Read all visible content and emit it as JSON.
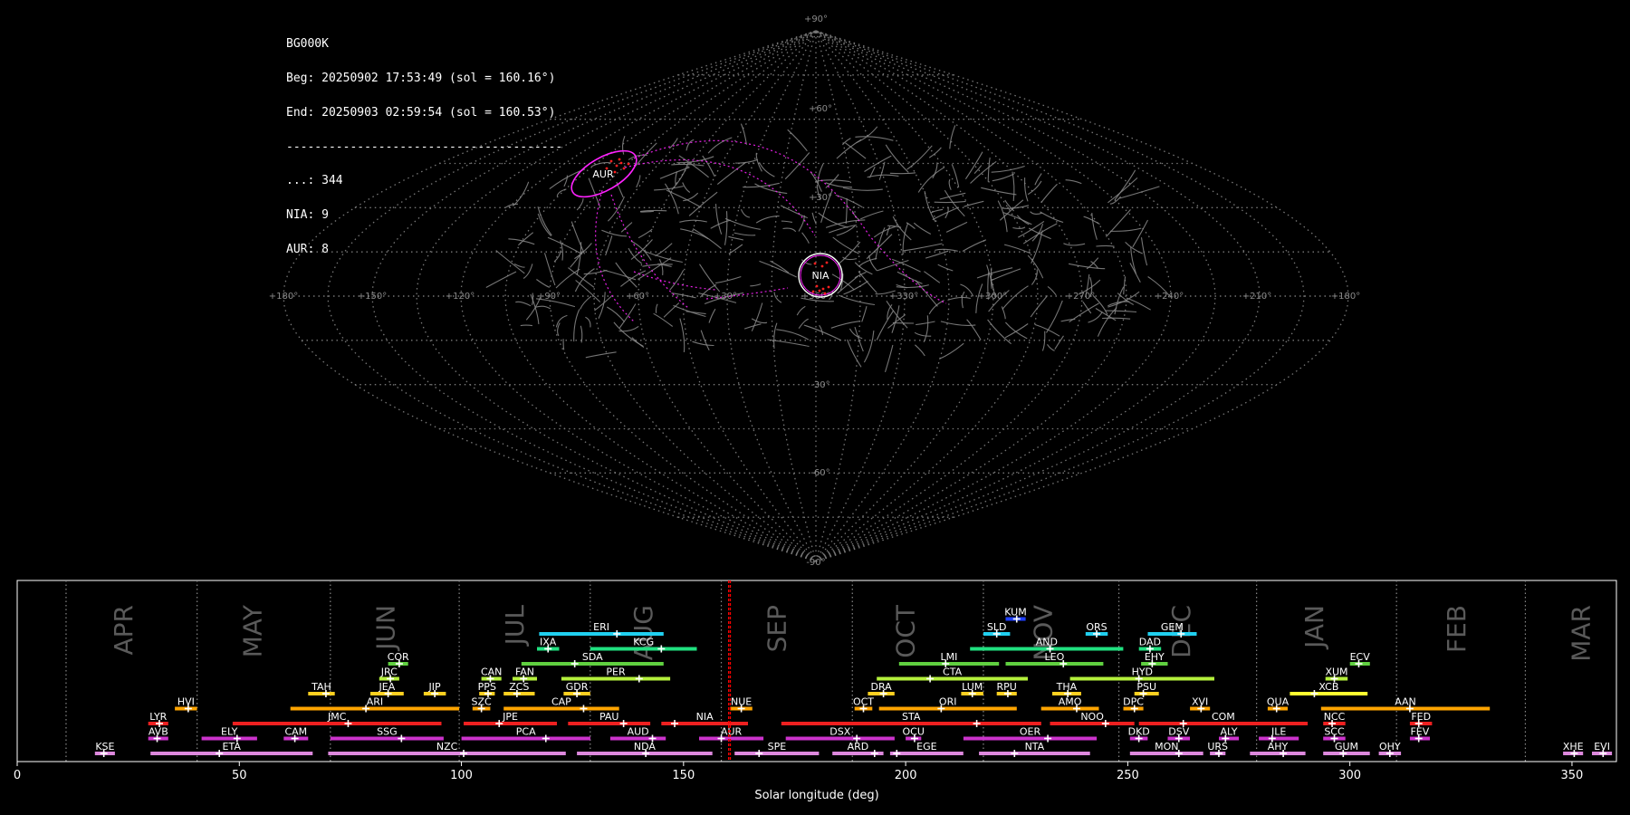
{
  "info": {
    "station": "BG000K",
    "beg": "Beg: 20250902 17:53:49 (sol = 160.16°)",
    "end": "End: 20250903 02:59:54 (sol = 160.53°)",
    "separator": "---------------------------------------",
    "counts": [
      "...: 344",
      "NIA: 9",
      "AUR: 8"
    ]
  },
  "sky": {
    "lat_labels": [
      "+90°",
      "+60°",
      "+30°",
      "-30°",
      "-60°",
      "-90°"
    ],
    "lon_labels": [
      "+180°",
      "+150°",
      "+120°",
      "+90°",
      "+60°",
      "+30°",
      "+360°",
      "+330°",
      "+300°",
      "+270°",
      "+240°",
      "+210°",
      "+180°"
    ],
    "highlight_radiants": [
      "AUR",
      "NIA"
    ],
    "colors": {
      "grid": "#777777",
      "tracks": "#8a8a8a",
      "highlight": "#ff22ff",
      "radiant_point": "#ff2020"
    }
  },
  "chart_data": {
    "type": "timeline",
    "xlabel": "Solar longitude (deg)",
    "xlim": [
      0,
      360
    ],
    "xticks": [
      0,
      50,
      100,
      150,
      200,
      250,
      300,
      350
    ],
    "current_sol": [
      160.16,
      160.53
    ],
    "month_labels": [
      {
        "name": "APR",
        "x": 24
      },
      {
        "name": "MAY",
        "x": 53
      },
      {
        "name": "JUN",
        "x": 83
      },
      {
        "name": "JUL",
        "x": 112
      },
      {
        "name": "AUG",
        "x": 141
      },
      {
        "name": "SEP",
        "x": 171
      },
      {
        "name": "OCT",
        "x": 200
      },
      {
        "name": "NOV",
        "x": 231
      },
      {
        "name": "DEC",
        "x": 262
      },
      {
        "name": "JAN",
        "x": 292
      },
      {
        "name": "FEB",
        "x": 324
      },
      {
        "name": "MAR",
        "x": 352
      }
    ],
    "month_boundaries": [
      11,
      40.5,
      70.5,
      99.5,
      129,
      158.5,
      188,
      217.5,
      248,
      279,
      310.5,
      339.5
    ],
    "showers": [
      {
        "name": "KSE",
        "start": 17.5,
        "end": 22,
        "peak": 19.5,
        "row": 0,
        "color": "#dd88dd"
      },
      {
        "name": "ETA",
        "start": 30,
        "end": 66.5,
        "peak": 45.5,
        "row": 0,
        "color": "#dd88dd"
      },
      {
        "name": "NZC",
        "start": 70,
        "end": 123.5,
        "peak": 100.5,
        "row": 0,
        "color": "#dd88dd"
      },
      {
        "name": "NDA",
        "start": 126,
        "end": 156.5,
        "peak": 141.5,
        "row": 0,
        "color": "#dd88dd"
      },
      {
        "name": "SPE",
        "start": 161.5,
        "end": 180.5,
        "peak": 167,
        "row": 0,
        "color": "#dd88dd"
      },
      {
        "name": "ARD",
        "start": 183.5,
        "end": 195,
        "peak": 193,
        "row": 0,
        "color": "#dd88dd"
      },
      {
        "name": "EGE",
        "start": 196.5,
        "end": 213,
        "peak": 198,
        "row": 0,
        "color": "#dd88dd"
      },
      {
        "name": "NTA",
        "start": 216.5,
        "end": 241.5,
        "peak": 224.5,
        "row": 0,
        "color": "#dd88dd"
      },
      {
        "name": "MON",
        "start": 250.5,
        "end": 267,
        "peak": 261.5,
        "row": 0,
        "color": "#dd88dd"
      },
      {
        "name": "URS",
        "start": 268.5,
        "end": 272,
        "peak": 270.5,
        "row": 0,
        "color": "#dd88dd"
      },
      {
        "name": "AHY",
        "start": 277.5,
        "end": 290,
        "peak": 285,
        "row": 0,
        "color": "#dd88dd"
      },
      {
        "name": "GUM",
        "start": 294,
        "end": 304.5,
        "peak": 298.5,
        "row": 0,
        "color": "#dd88dd"
      },
      {
        "name": "OHY",
        "start": 306.5,
        "end": 311.5,
        "peak": 309,
        "row": 0,
        "color": "#dd88dd"
      },
      {
        "name": "XHE",
        "start": 348,
        "end": 352.5,
        "peak": 350.5,
        "row": 0,
        "color": "#dd88dd"
      },
      {
        "name": "EVI",
        "start": 354.5,
        "end": 359,
        "peak": 357,
        "row": 0,
        "color": "#dd88dd"
      },
      {
        "name": "AVB",
        "start": 29.5,
        "end": 34,
        "peak": 31.5,
        "row": 1,
        "color": "#cc33cc"
      },
      {
        "name": "ELY",
        "start": 41.5,
        "end": 54,
        "peak": 49.5,
        "row": 1,
        "color": "#cc33cc"
      },
      {
        "name": "CAM",
        "start": 60,
        "end": 65.5,
        "peak": 62.5,
        "row": 1,
        "color": "#cc33cc"
      },
      {
        "name": "SSG",
        "start": 70.5,
        "end": 96,
        "peak": 86.5,
        "row": 1,
        "color": "#cc33cc"
      },
      {
        "name": "PCA",
        "start": 100,
        "end": 129,
        "peak": 119,
        "row": 1,
        "color": "#cc33cc"
      },
      {
        "name": "AUD",
        "start": 133.5,
        "end": 146,
        "peak": 143,
        "row": 1,
        "color": "#cc33cc"
      },
      {
        "name": "AUR",
        "start": 153.5,
        "end": 168,
        "peak": 158.5,
        "row": 1,
        "color": "#cc33cc"
      },
      {
        "name": "DSX",
        "start": 173,
        "end": 197.5,
        "peak": 189,
        "row": 1,
        "color": "#cc33cc"
      },
      {
        "name": "OCU",
        "start": 200,
        "end": 203.5,
        "peak": 202,
        "row": 1,
        "color": "#cc33cc"
      },
      {
        "name": "OER",
        "start": 213,
        "end": 243,
        "peak": 232,
        "row": 1,
        "color": "#cc33cc"
      },
      {
        "name": "DKD",
        "start": 250.5,
        "end": 254.5,
        "peak": 252.5,
        "row": 1,
        "color": "#cc33cc"
      },
      {
        "name": "DSV",
        "start": 259,
        "end": 264,
        "peak": 261.5,
        "row": 1,
        "color": "#cc33cc"
      },
      {
        "name": "ALY",
        "start": 270.5,
        "end": 275,
        "peak": 272,
        "row": 1,
        "color": "#cc33cc"
      },
      {
        "name": "ILE",
        "start": 279.5,
        "end": 288.5,
        "peak": 282.5,
        "row": 1,
        "color": "#cc33cc"
      },
      {
        "name": "SCC",
        "start": 294,
        "end": 299,
        "peak": 296.5,
        "row": 1,
        "color": "#cc33cc"
      },
      {
        "name": "FEV",
        "start": 313.5,
        "end": 318,
        "peak": 315.5,
        "row": 1,
        "color": "#cc33cc"
      },
      {
        "name": "LYR",
        "start": 29.5,
        "end": 34,
        "peak": 32,
        "row": 2,
        "color": "#ee2020"
      },
      {
        "name": "JMC",
        "start": 48.5,
        "end": 95.5,
        "peak": 74.5,
        "row": 2,
        "color": "#ee2020"
      },
      {
        "name": "JPE",
        "start": 100.5,
        "end": 121.5,
        "peak": 108.5,
        "row": 2,
        "color": "#ee2020"
      },
      {
        "name": "PAU",
        "start": 124,
        "end": 142.5,
        "peak": 136.5,
        "row": 2,
        "color": "#ee2020"
      },
      {
        "name": "NIA",
        "start": 145,
        "end": 164.5,
        "peak": 148,
        "row": 2,
        "color": "#ee2020"
      },
      {
        "name": "STA",
        "start": 172,
        "end": 230.5,
        "peak": 216,
        "row": 2,
        "color": "#ee2020"
      },
      {
        "name": "NOO",
        "start": 232.5,
        "end": 251.5,
        "peak": 245,
        "row": 2,
        "color": "#ee2020"
      },
      {
        "name": "COM",
        "start": 252.5,
        "end": 290.5,
        "peak": 262.5,
        "row": 2,
        "color": "#ee2020"
      },
      {
        "name": "NCC",
        "start": 294,
        "end": 299,
        "peak": 296,
        "row": 2,
        "color": "#ee2020"
      },
      {
        "name": "FED",
        "start": 313.5,
        "end": 318.5,
        "peak": 315.5,
        "row": 2,
        "color": "#ee2020"
      },
      {
        "name": "HVI",
        "start": 35.5,
        "end": 40.5,
        "peak": 38.5,
        "row": 3,
        "color": "#ffa500"
      },
      {
        "name": "ARI",
        "start": 61.5,
        "end": 99.5,
        "peak": 78.5,
        "row": 3,
        "color": "#ffa500"
      },
      {
        "name": "SZC",
        "start": 102.5,
        "end": 106.5,
        "peak": 104.5,
        "row": 3,
        "color": "#ffa500"
      },
      {
        "name": "CAP",
        "start": 109.5,
        "end": 135.5,
        "peak": 127.5,
        "row": 3,
        "color": "#ffa500"
      },
      {
        "name": "NUE",
        "start": 160.5,
        "end": 165.5,
        "peak": 163,
        "row": 3,
        "color": "#ffa500"
      },
      {
        "name": "OCT",
        "start": 188.5,
        "end": 192.5,
        "peak": 190.5,
        "row": 3,
        "color": "#ffa500"
      },
      {
        "name": "ORI",
        "start": 194,
        "end": 225,
        "peak": 208,
        "row": 3,
        "color": "#ffa500"
      },
      {
        "name": "AMO",
        "start": 230.5,
        "end": 243.5,
        "peak": 238.5,
        "row": 3,
        "color": "#ffa500"
      },
      {
        "name": "DPC",
        "start": 249,
        "end": 253.5,
        "peak": 251.5,
        "row": 3,
        "color": "#ffa500"
      },
      {
        "name": "XVI",
        "start": 264,
        "end": 268.5,
        "peak": 266.5,
        "row": 3,
        "color": "#ffa500"
      },
      {
        "name": "QUA",
        "start": 281.5,
        "end": 286,
        "peak": 283.5,
        "row": 3,
        "color": "#ffa500"
      },
      {
        "name": "AAN",
        "start": 293.5,
        "end": 331.5,
        "peak": 313.5,
        "row": 3,
        "color": "#ffa500"
      },
      {
        "name": "TAH",
        "start": 65.5,
        "end": 71.5,
        "peak": 69.5,
        "row": 4,
        "color": "#ffd020"
      },
      {
        "name": "JEA",
        "start": 79.5,
        "end": 87,
        "peak": 83.5,
        "row": 4,
        "color": "#ffd020"
      },
      {
        "name": "JIP",
        "start": 91.5,
        "end": 96.5,
        "peak": 94,
        "row": 4,
        "color": "#ffd020"
      },
      {
        "name": "PPS",
        "start": 104,
        "end": 107.5,
        "peak": 106,
        "row": 4,
        "color": "#ffd020"
      },
      {
        "name": "ZCS",
        "start": 109.5,
        "end": 116.5,
        "peak": 112.5,
        "row": 4,
        "color": "#ffd020"
      },
      {
        "name": "GDR",
        "start": 123,
        "end": 129,
        "peak": 126,
        "row": 4,
        "color": "#ffd020"
      },
      {
        "name": "DRA",
        "start": 191.5,
        "end": 197.5,
        "peak": 195,
        "row": 4,
        "color": "#ffd020"
      },
      {
        "name": "LUM",
        "start": 212.5,
        "end": 217.5,
        "peak": 215,
        "row": 4,
        "color": "#ffd020"
      },
      {
        "name": "RPU",
        "start": 220.5,
        "end": 225,
        "peak": 223,
        "row": 4,
        "color": "#ffd020"
      },
      {
        "name": "THA",
        "start": 233,
        "end": 239.5,
        "peak": 236.5,
        "row": 4,
        "color": "#ffd020"
      },
      {
        "name": "PSU",
        "start": 251.5,
        "end": 257,
        "peak": 253.5,
        "row": 4,
        "color": "#ffd020"
      },
      {
        "name": "XCB",
        "start": 286.5,
        "end": 304,
        "peak": 292,
        "row": 4,
        "color": "#ffff30"
      },
      {
        "name": "JRC",
        "start": 81.5,
        "end": 86,
        "peak": 84,
        "row": 5,
        "color": "#b4f03c"
      },
      {
        "name": "CAN",
        "start": 104.5,
        "end": 109,
        "peak": 106.5,
        "row": 5,
        "color": "#b4f03c"
      },
      {
        "name": "FAN",
        "start": 111.5,
        "end": 117,
        "peak": 114,
        "row": 5,
        "color": "#b4f03c"
      },
      {
        "name": "PER",
        "start": 122.5,
        "end": 147,
        "peak": 140,
        "row": 5,
        "color": "#b4f03c"
      },
      {
        "name": "CTA",
        "start": 193.5,
        "end": 227.5,
        "peak": 205.5,
        "row": 5,
        "color": "#b4f03c"
      },
      {
        "name": "HYD",
        "start": 237,
        "end": 269.5,
        "peak": 252.5,
        "row": 5,
        "color": "#b4f03c"
      },
      {
        "name": "XUM",
        "start": 294.5,
        "end": 299.5,
        "peak": 296.5,
        "row": 5,
        "color": "#b4f03c"
      },
      {
        "name": "COR",
        "start": 83.5,
        "end": 88,
        "peak": 86,
        "row": 6,
        "color": "#60d040"
      },
      {
        "name": "SDA",
        "start": 113.5,
        "end": 145.5,
        "peak": 125.5,
        "row": 6,
        "color": "#60d040"
      },
      {
        "name": "LMI",
        "start": 198.5,
        "end": 221,
        "peak": 209,
        "row": 6,
        "color": "#60d040"
      },
      {
        "name": "LEO",
        "start": 222.5,
        "end": 244.5,
        "peak": 235.5,
        "row": 6,
        "color": "#60d040"
      },
      {
        "name": "EHY",
        "start": 253,
        "end": 259,
        "peak": 255.5,
        "row": 6,
        "color": "#60d040"
      },
      {
        "name": "ECV",
        "start": 300,
        "end": 304.5,
        "peak": 302,
        "row": 6,
        "color": "#60d040"
      },
      {
        "name": "IXA",
        "start": 117,
        "end": 122,
        "peak": 119.5,
        "row": 7,
        "color": "#20e080"
      },
      {
        "name": "KCG",
        "start": 129,
        "end": 153,
        "peak": 145,
        "row": 7,
        "color": "#20e080"
      },
      {
        "name": "AND",
        "start": 214.5,
        "end": 249,
        "peak": 232.5,
        "row": 7,
        "color": "#20e080"
      },
      {
        "name": "DAD",
        "start": 252.5,
        "end": 257.5,
        "peak": 255,
        "row": 7,
        "color": "#20e080"
      },
      {
        "name": "ERI",
        "start": 117.5,
        "end": 145.5,
        "peak": 135,
        "row": 8,
        "color": "#20d0f0"
      },
      {
        "name": "SLD",
        "start": 217.5,
        "end": 223.5,
        "peak": 220.5,
        "row": 8,
        "color": "#20d0f0"
      },
      {
        "name": "ORS",
        "start": 240.5,
        "end": 245.5,
        "peak": 243,
        "row": 8,
        "color": "#20d0f0"
      },
      {
        "name": "GEM",
        "start": 254.5,
        "end": 265.5,
        "peak": 262,
        "row": 8,
        "color": "#20d0f0"
      },
      {
        "name": "KUM",
        "start": 222.5,
        "end": 227,
        "peak": 225,
        "row": 9,
        "color": "#2040ff"
      }
    ]
  }
}
